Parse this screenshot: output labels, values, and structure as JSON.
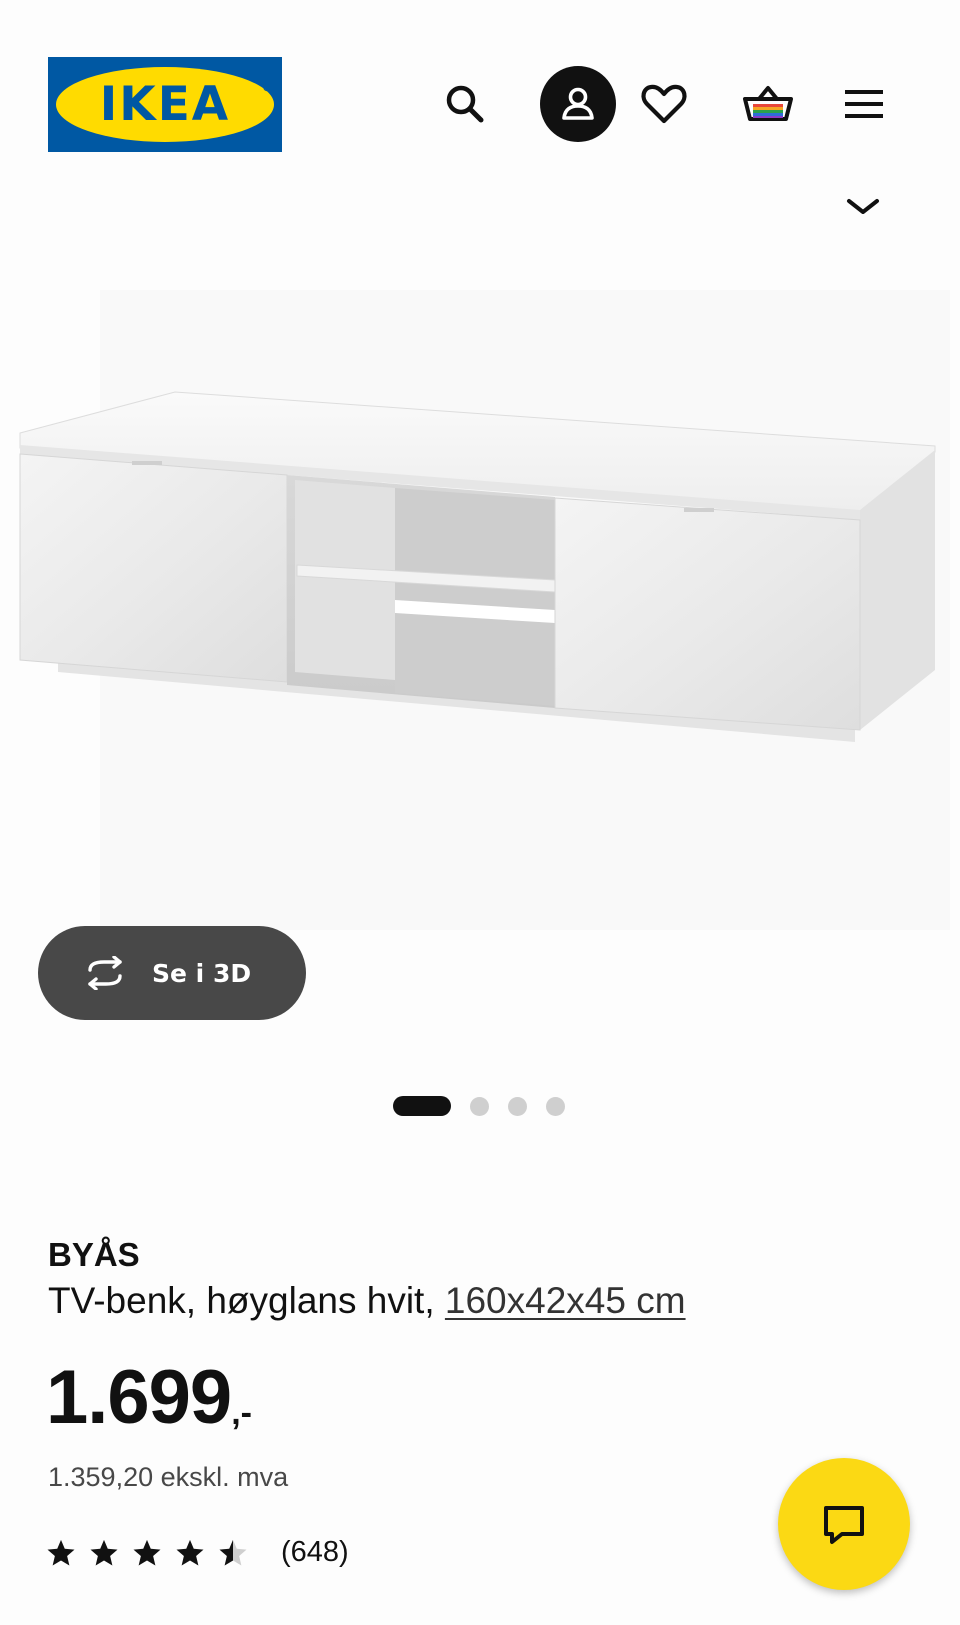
{
  "header": {
    "logo_text": "IKEA",
    "logo_registered": "®",
    "icons": {
      "search": "search-icon",
      "account": "user-icon",
      "wishlist": "heart-icon",
      "cart": "basket-icon",
      "menu": "hamburger-menu-icon",
      "expand": "chevron-down-icon"
    }
  },
  "product_image": {
    "icon": "product-photo-tv-bench"
  },
  "view_3d": {
    "label": "Se i 3D",
    "icon": "rotate-3d-icon"
  },
  "carousel": {
    "total": 4,
    "active_index": 0
  },
  "product": {
    "name": "BYÅS",
    "description": "TV-benk, høyglans hvit, ",
    "dimensions": "160x42x45 cm",
    "price": "1.699",
    "price_suffix": ",-",
    "price_ex_vat": "1.359,20 ekskl. mva",
    "rating_value": 4.5,
    "rating_max": 5,
    "review_count": "(648)"
  },
  "chat": {
    "icon": "chat-icon"
  },
  "colors": {
    "brand_blue": "#0058a3",
    "brand_yellow": "#ffdb00",
    "chat_yellow": "#fbd914",
    "button_dark": "#484848",
    "text": "#111111"
  }
}
